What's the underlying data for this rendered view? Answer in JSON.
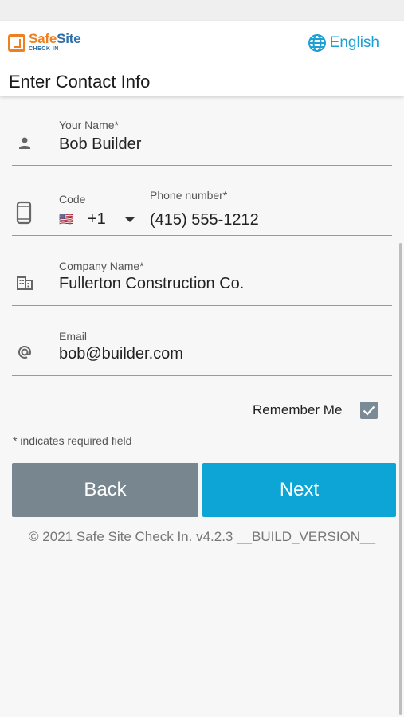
{
  "header": {
    "logo_main_a": "Safe",
    "logo_main_b": "Site",
    "logo_sub": "CHECK IN",
    "language": "English",
    "page_title": "Enter Contact Info"
  },
  "form": {
    "name": {
      "label": "Your Name*",
      "value": "Bob Builder",
      "icon": "person-icon"
    },
    "phone": {
      "code_label": "Code",
      "flag": "🇺🇸",
      "code_value": "+1",
      "number_label": "Phone number*",
      "number_value": "(415) 555-1212",
      "icon": "phone-icon"
    },
    "company": {
      "label": "Company Name*",
      "value": "Fullerton Construction Co.",
      "icon": "business-icon"
    },
    "email": {
      "label": "Email",
      "value": "bob@builder.com",
      "icon": "at-icon"
    }
  },
  "remember": {
    "label": "Remember Me",
    "checked": true
  },
  "required_note": "* indicates required field",
  "buttons": {
    "back": "Back",
    "next": "Next"
  },
  "footer": "© 2021 Safe Site Check In. v4.2.3 __BUILD_VERSION__",
  "colors": {
    "accent": "#0da5d6",
    "back_button": "#77868f",
    "logo_orange": "#f07f1e",
    "logo_blue": "#2f6fa8"
  }
}
